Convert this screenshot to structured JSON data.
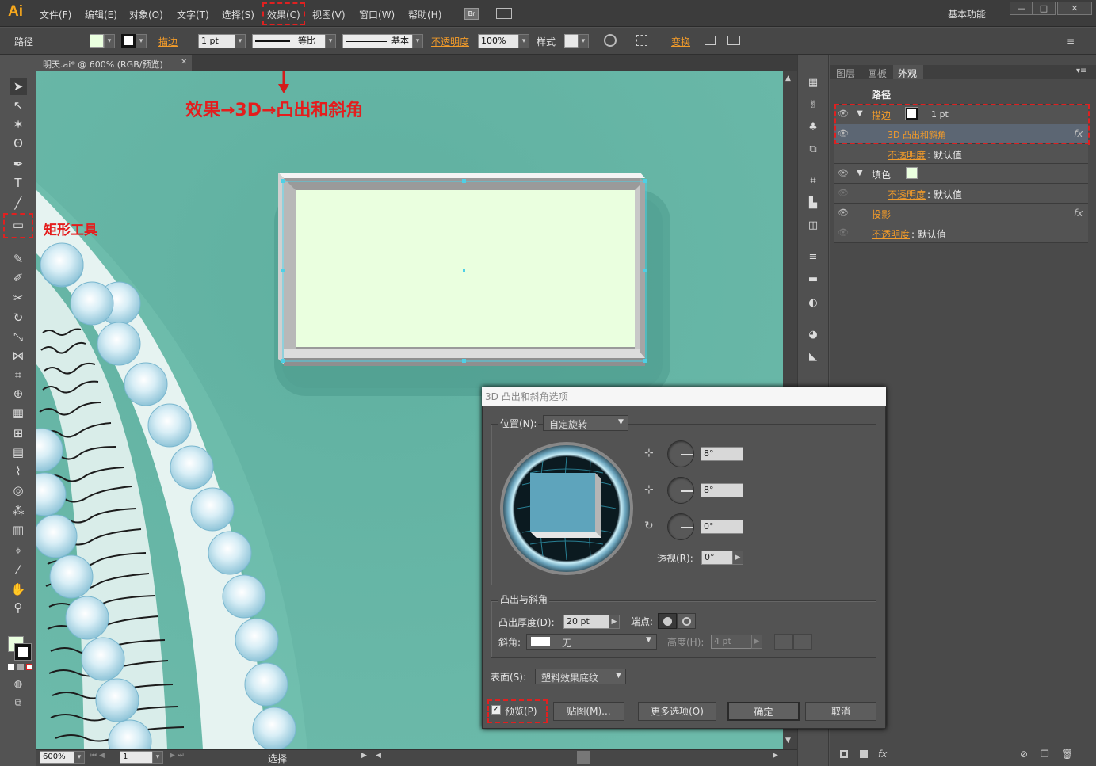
{
  "app": {
    "logo": "Ai",
    "workspace": "基本功能"
  },
  "menu": [
    "文件(F)",
    "编辑(E)",
    "对象(O)",
    "文字(T)",
    "选择(S)",
    "效果(C)",
    "视图(V)",
    "窗口(W)",
    "帮助(H)"
  ],
  "bridge_label": "Br",
  "window_buttons": [
    "—",
    "□",
    "✕"
  ],
  "control": {
    "object_type": "路径",
    "stroke_label": "描边",
    "stroke_value": "1 pt",
    "profile_label": "等比",
    "brush_label": "基本",
    "opacity_label": "不透明度",
    "opacity_value": "100%",
    "style_label": "样式",
    "transform_label": "变换"
  },
  "document_tab": {
    "title": "明天.ai* @ 600% (RGB/预览)",
    "close": "✕"
  },
  "annotations": {
    "menu_path": "效果→3D→凸出和斜角",
    "rect_tool": "矩形工具"
  },
  "status": {
    "zoom": "600%",
    "page": "1",
    "tool": "选择"
  },
  "panel": {
    "tabs": [
      "图层",
      "画板",
      "外观"
    ],
    "active_tab": "外观",
    "header": "路径",
    "rows": [
      {
        "label": "描边",
        "value": "1 pt"
      },
      {
        "label": "3D 凸出和斜角",
        "fx": "fx"
      },
      {
        "label": "不透明度",
        "value": "默认值"
      },
      {
        "label": "填色",
        "value": ""
      },
      {
        "label": "不透明度",
        "value": "默认值"
      },
      {
        "label": "投影",
        "fx": "fx"
      },
      {
        "label": "不透明度",
        "value": "默认值"
      }
    ],
    "footer_fx": "fx"
  },
  "dialog": {
    "title": "3D 凸出和斜角选项",
    "position_label": "位置(N):",
    "position_value": "自定旋转",
    "angle_x": "8°",
    "angle_y": "8°",
    "angle_z": "0°",
    "perspective_label": "透视(R):",
    "perspective_value": "0°",
    "extrude_group": "凸出与斜角",
    "depth_label": "凸出厚度(D):",
    "depth_value": "20 pt",
    "cap_label": "端点:",
    "bevel_label": "斜角:",
    "bevel_value": "无",
    "height_label": "高度(H):",
    "height_value": "4 pt",
    "surface_label": "表面(S):",
    "surface_value": "塑料效果底纹",
    "preview_label": "预览(P)",
    "map_button": "贴图(M)...",
    "more_button": "更多选项(O)",
    "ok_button": "确定",
    "cancel_button": "取消"
  },
  "colors": {
    "canvas": "#67b7a6",
    "rect_fill": "#eaffdf",
    "annotation_red": "#e41d1d",
    "orange_label": "#f29b2a",
    "sphere": "#aed9ea"
  }
}
